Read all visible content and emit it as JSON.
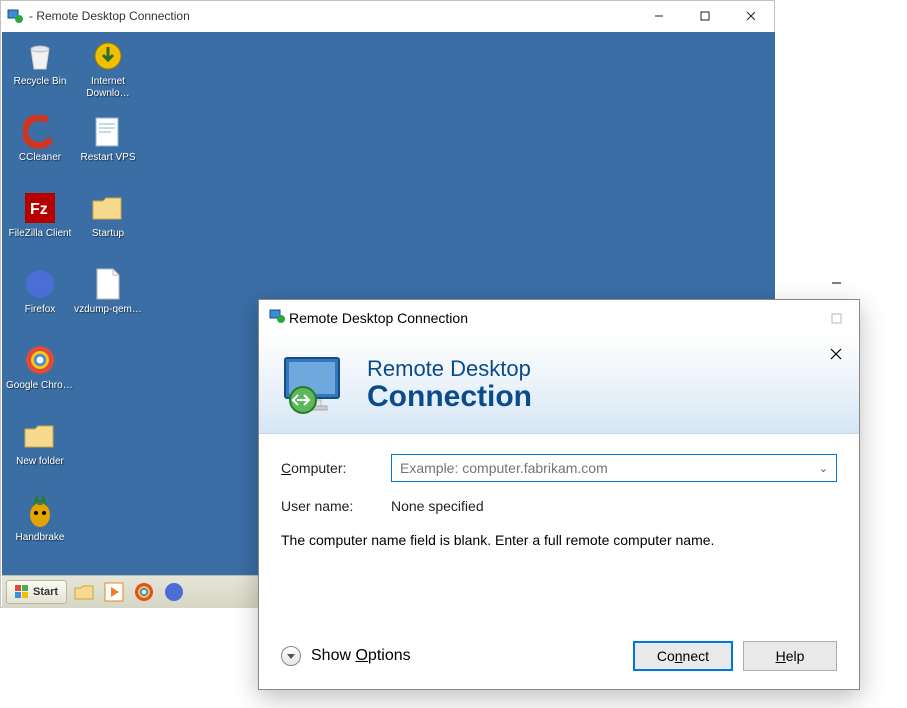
{
  "outerWindow": {
    "title": "- Remote Desktop Connection"
  },
  "desktopIcons": [
    {
      "key": "recycle-bin",
      "label": "Recycle Bin"
    },
    {
      "key": "idm",
      "label": "Internet Downlo…"
    },
    {
      "key": "ccleaner",
      "label": "CCleaner"
    },
    {
      "key": "restart-vps",
      "label": "Restart VPS"
    },
    {
      "key": "filezilla",
      "label": "FileZilla Client"
    },
    {
      "key": "startup",
      "label": "Startup"
    },
    {
      "key": "firefox",
      "label": "Firefox"
    },
    {
      "key": "vzdump",
      "label": "vzdump-qem…"
    },
    {
      "key": "chrome",
      "label": "Google Chrome"
    },
    {
      "key": "newfolder",
      "label": "New folder"
    },
    {
      "key": "handbrake",
      "label": "Handbrake"
    }
  ],
  "taskbar": {
    "startLabel": "Start"
  },
  "rdpDialog": {
    "title": "Remote Desktop Connection",
    "headerLine1": "Remote Desktop",
    "headerLine2": "Connection",
    "computerLabel": "Computer:",
    "computerPlaceholder": "Example: computer.fabrikam.com",
    "userLabel": "User name:",
    "userValue": "None specified",
    "statusText": "The computer name field is blank. Enter a full remote computer name.",
    "showOptions": "Show Options",
    "connect": "Connect",
    "help": "Help"
  }
}
